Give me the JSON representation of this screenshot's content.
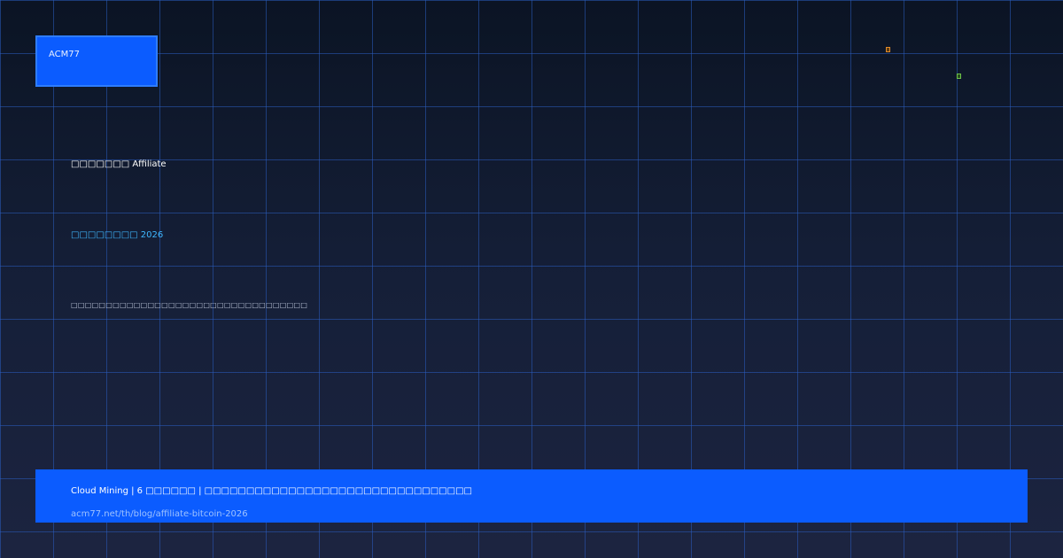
{
  "brand": {
    "logo_text": "ACM77"
  },
  "hero": {
    "headline": "□□□□□□□ Affiliate",
    "subline": "□□□□□□□□ 2026",
    "description": "□□□□□□□□□□□□□□□□□□□□□□□□□□□□□□□□□□"
  },
  "footer": {
    "title": "Cloud Mining | 6 □□□□□□ | □□□□□□□□□□□□□□□□□□□□□□□□□□□□□□□□",
    "url": "acm77.net/th/blog/affiliate-bitcoin-2026"
  },
  "colors": {
    "accent": "#0b5cff",
    "grid": "#2a5cbe",
    "link": "#3fb8ff",
    "background_top": "#0b1424",
    "background_bottom": "#1c2440"
  }
}
